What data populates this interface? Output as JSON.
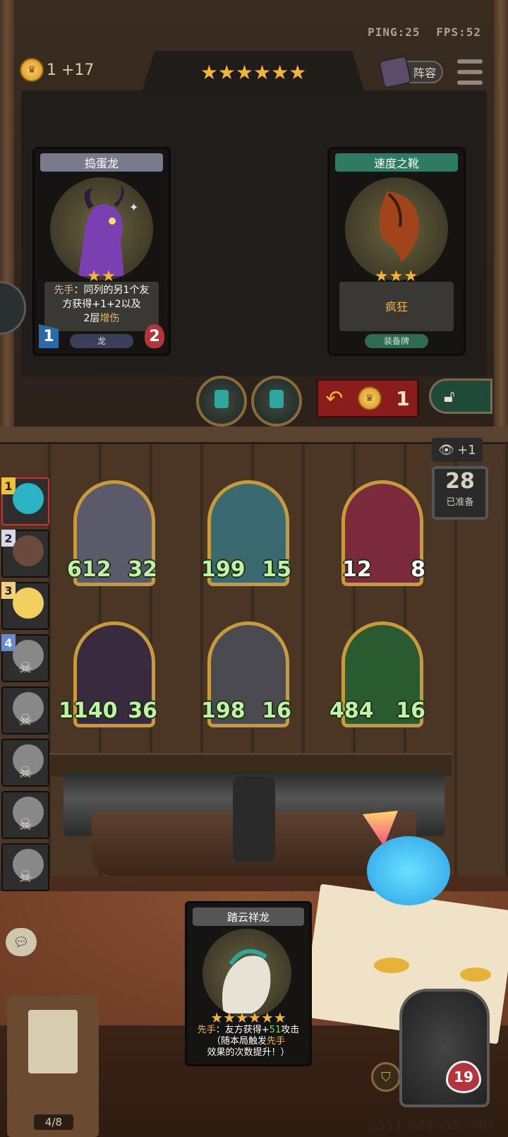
{
  "hud": {
    "ping": "PING:25",
    "fps": "FPS:52",
    "gold_text": "1 +17",
    "lineup_label": "阵容",
    "tier_stars": "★★★★★★"
  },
  "shop": {
    "cards": [
      {
        "name": "捣蛋龙",
        "stars": "★★",
        "desc_prefix": "先手",
        "desc_line1": "：同列的另1个友",
        "desc_line2": "方获得+1+2以及",
        "desc_line3_a": "2层",
        "desc_line3_b": "增伤",
        "tag": "龙",
        "attack": "1",
        "health": "2",
        "header_color": "#7a7a8e"
      },
      {
        "name": "速度之靴",
        "stars": "★★★",
        "desc": "疯狂",
        "tag": "装备牌",
        "header_color": "#2f7a62"
      }
    ],
    "refresh_cost": "1"
  },
  "board": {
    "vision_bonus": "+1",
    "ready_count": "28",
    "ready_label": "已准备",
    "units": [
      {
        "attack": "612",
        "health": "32",
        "atk_white": false,
        "hp_white": false
      },
      {
        "attack": "199",
        "health": "15",
        "atk_white": false,
        "hp_white": false
      },
      {
        "attack": "12",
        "health": "8",
        "atk_white": true,
        "hp_white": true
      },
      {
        "attack": "1140",
        "health": "36",
        "atk_white": false,
        "hp_white": false
      },
      {
        "attack": "198",
        "health": "16",
        "atk_white": false,
        "hp_white": false
      },
      {
        "attack": "484",
        "health": "16",
        "atk_white": false,
        "hp_white": false
      }
    ]
  },
  "players": [
    {
      "rank": "1",
      "dead": false
    },
    {
      "rank": "2",
      "dead": false
    },
    {
      "rank": "3",
      "dead": false
    },
    {
      "rank": "4",
      "dead": true
    },
    {
      "rank": "",
      "dead": true
    },
    {
      "rank": "",
      "dead": true
    },
    {
      "rank": "",
      "dead": true
    },
    {
      "rank": "",
      "dead": true
    }
  ],
  "hand": {
    "name": "踏云祥龙",
    "stars": "★★★★★★",
    "desc_prefix": "先手",
    "desc_a": "：友方获得+",
    "desc_num": "51",
    "desc_b": "攻击",
    "desc_line2_a": "（随本局触发",
    "desc_line2_hl": "先手",
    "desc_line3": "效果的次数提升！）"
  },
  "bottom": {
    "bounty_count": "4/8",
    "hero_health": "19",
    "player_id": "2521 6685563701"
  }
}
